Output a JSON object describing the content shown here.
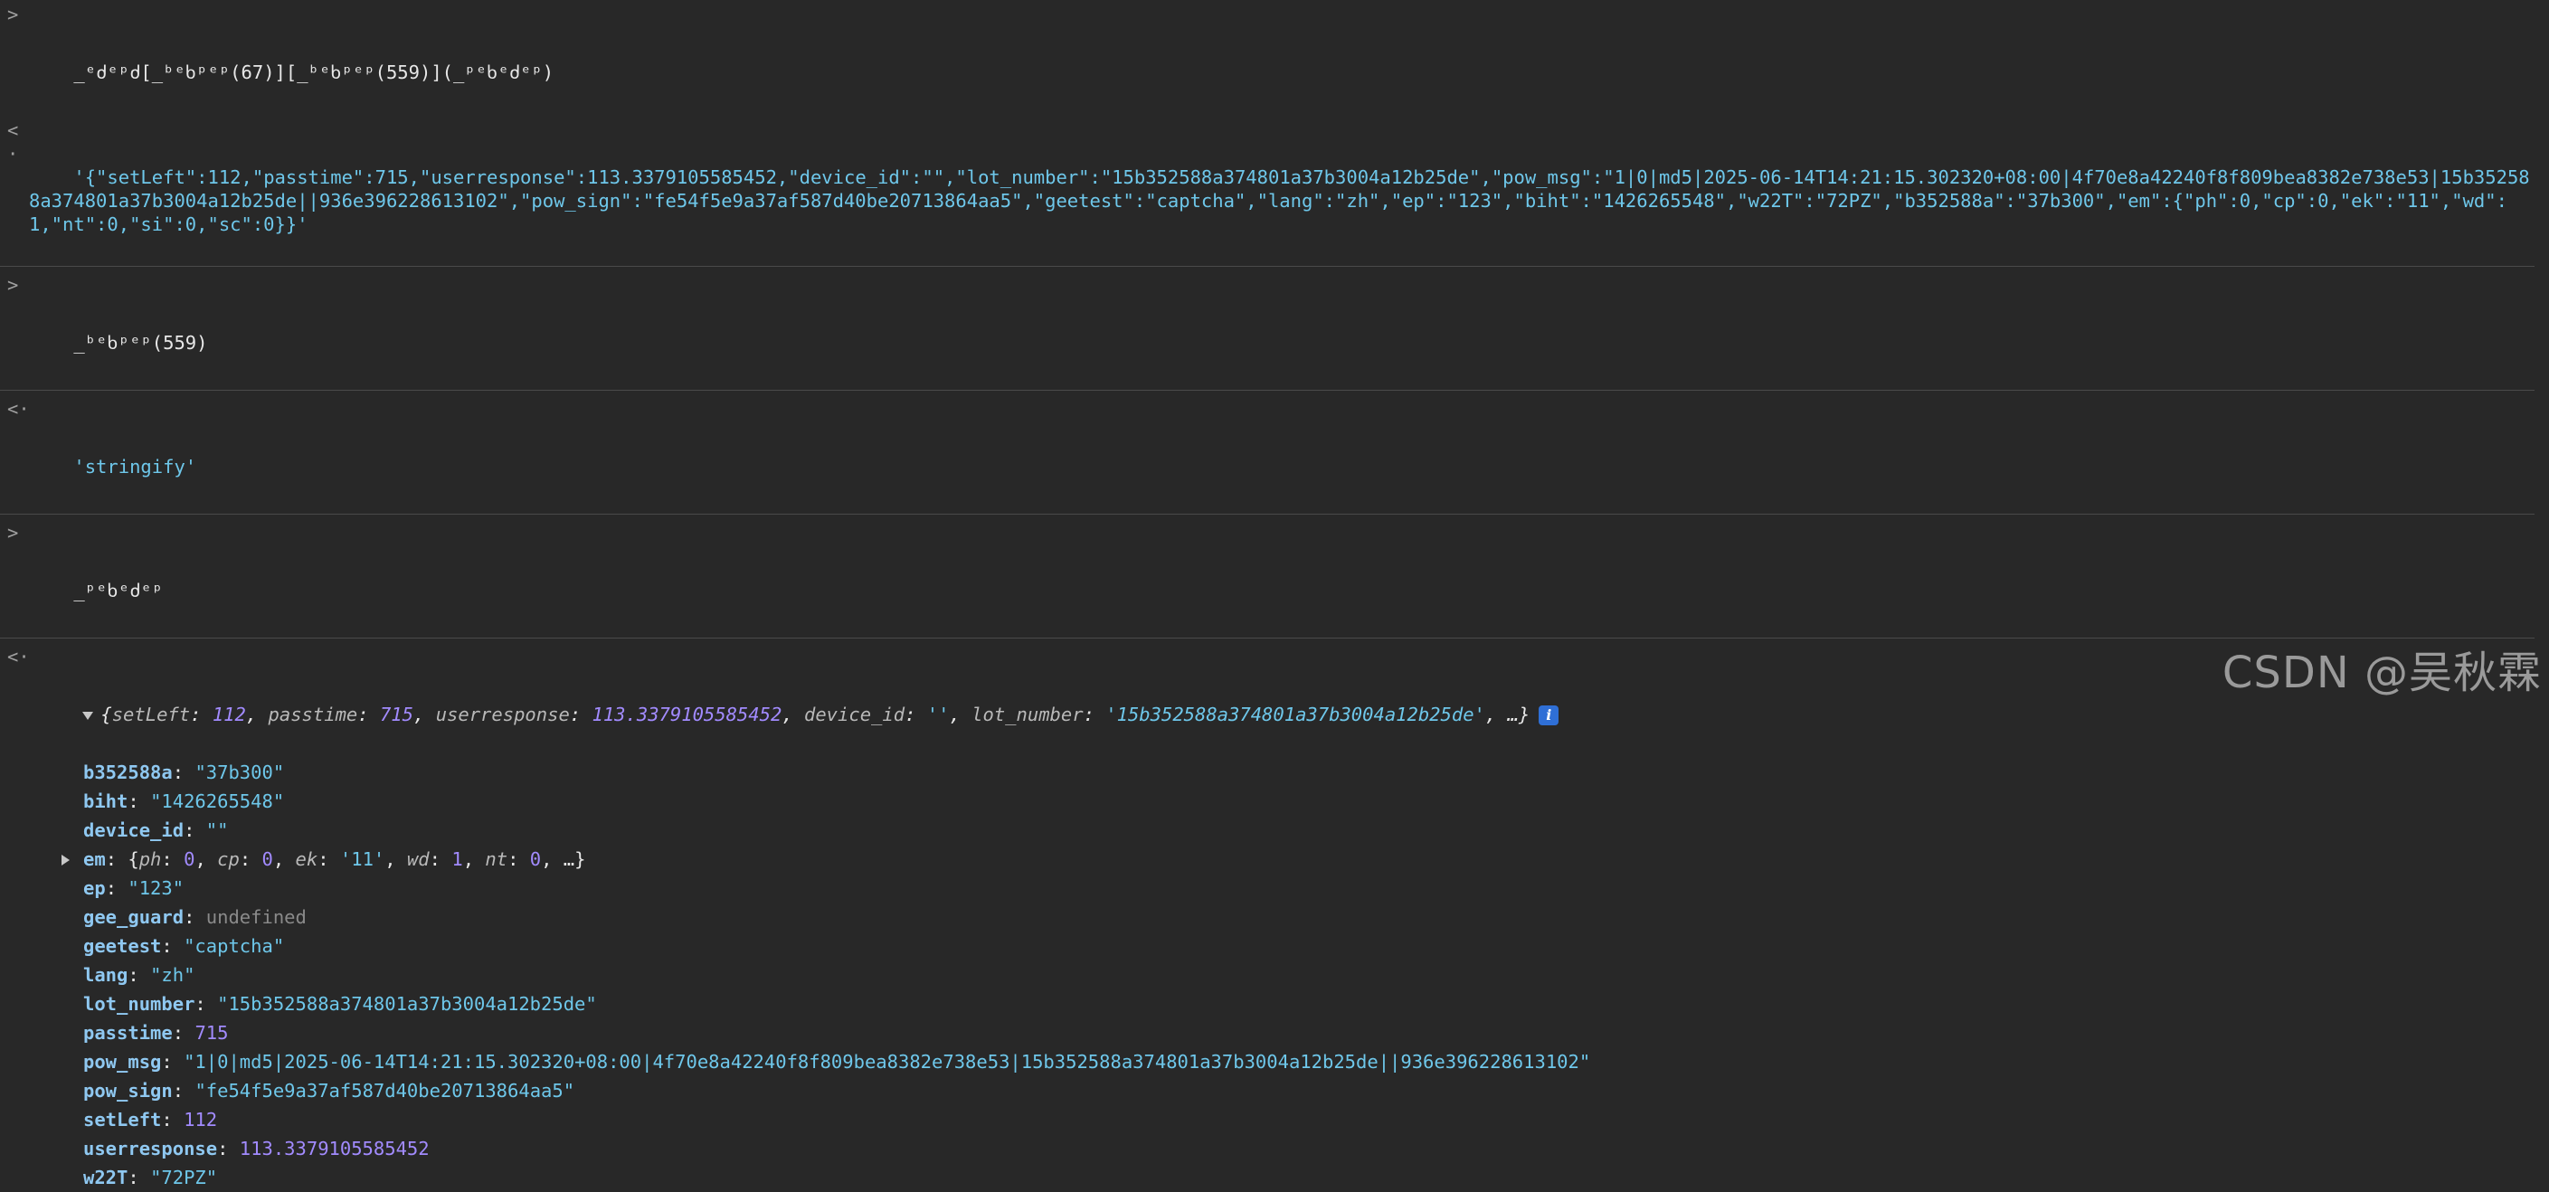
{
  "colors": {
    "background": "#282828",
    "string": "#6ec7ea",
    "number": "#a28bff",
    "key": "#8fc8f1",
    "info_badge": "#2f6fd6"
  },
  "icons": {
    "prompt": "chevron-right-icon",
    "result": "chevron-left-icon",
    "expand": "triangle-down-icon",
    "collapsed": "triangle-right-icon",
    "info": "info-icon"
  },
  "console": {
    "entries": [
      {
        "input": "_ᵉძᵉᵖძ[_ᵇᵉხᵖᵉᵖ(67)][_ᵇᵉხᵖᵉᵖ(559)](_ᵖᵉხᵉძᵉᵖ)",
        "output": "'{\"setLeft\":112,\"passtime\":715,\"userresponse\":113.3379105585452,\"device_id\":\"\",\"lot_number\":\"15b352588a374801a37b3004a12b25de\",\"pow_msg\":\"1|0|md5|2025-06-14T14:21:15.302320+08:00|4f70e8a42240f8f809bea8382e738e53|15b352588a374801a37b3004a12b25de||936e396228613102\",\"pow_sign\":\"fe54f5e9a37af587d40be20713864aa5\",\"geetest\":\"captcha\",\"lang\":\"zh\",\"ep\":\"123\",\"biht\":\"1426265548\",\"w22T\":\"72PZ\",\"b352588a\":\"37b300\",\"em\":{\"ph\":0,\"cp\":0,\"ek\":\"11\",\"wd\":1,\"nt\":0,\"si\":0,\"sc\":0}}'"
      },
      {
        "input": "_ᵇᵉხᵖᵉᵖ(559)",
        "output": "'stringify'"
      },
      {
        "input": "_ᵖᵉხᵉძᵉᵖ"
      }
    ],
    "object_preview": {
      "open": "{",
      "items": [
        {
          "key": "setLeft",
          "value": "112",
          "kind": "num"
        },
        {
          "key": "passtime",
          "value": "715",
          "kind": "num"
        },
        {
          "key": "userresponse",
          "value": "113.3379105585452",
          "kind": "num"
        },
        {
          "key": "device_id",
          "value": "''",
          "kind": "str"
        },
        {
          "key": "lot_number",
          "value": "'15b352588a374801a37b3004a12b25de'",
          "kind": "str"
        }
      ],
      "close": ", …}",
      "info_label": "i"
    },
    "properties": [
      {
        "key": "b352588a",
        "value": "\"37b300\"",
        "kind": "str"
      },
      {
        "key": "biht",
        "value": "\"1426265548\"",
        "kind": "str"
      },
      {
        "key": "device_id",
        "value": "\"\"",
        "kind": "str"
      },
      {
        "key": "em",
        "value": "",
        "kind": "obj",
        "collapsed": true,
        "preview": {
          "items": [
            {
              "key": "ph",
              "value": "0",
              "kind": "num"
            },
            {
              "key": "cp",
              "value": "0",
              "kind": "num"
            },
            {
              "key": "ek",
              "value": "'11'",
              "kind": "str"
            },
            {
              "key": "wd",
              "value": "1",
              "kind": "num"
            },
            {
              "key": "nt",
              "value": "0",
              "kind": "num"
            }
          ],
          "close": ", …}"
        }
      },
      {
        "key": "ep",
        "value": "\"123\"",
        "kind": "str"
      },
      {
        "key": "gee_guard",
        "value": "undefined",
        "kind": "undef"
      },
      {
        "key": "geetest",
        "value": "\"captcha\"",
        "kind": "str"
      },
      {
        "key": "lang",
        "value": "\"zh\"",
        "kind": "str"
      },
      {
        "key": "lot_number",
        "value": "\"15b352588a374801a37b3004a12b25de\"",
        "kind": "str"
      },
      {
        "key": "passtime",
        "value": "715",
        "kind": "num"
      },
      {
        "key": "pow_msg",
        "value": "\"1|0|md5|2025-06-14T14:21:15.302320+08:00|4f70e8a42240f8f809bea8382e738e53|15b352588a374801a37b3004a12b25de||936e396228613102\"",
        "kind": "str"
      },
      {
        "key": "pow_sign",
        "value": "\"fe54f5e9a37af587d40be20713864aa5\"",
        "kind": "str"
      },
      {
        "key": "setLeft",
        "value": "112",
        "kind": "num"
      },
      {
        "key": "userresponse",
        "value": "113.3379105585452",
        "kind": "num"
      },
      {
        "key": "w22T",
        "value": "\"72PZ\"",
        "kind": "str"
      }
    ]
  },
  "watermark": "CSDN @吴秋霖"
}
